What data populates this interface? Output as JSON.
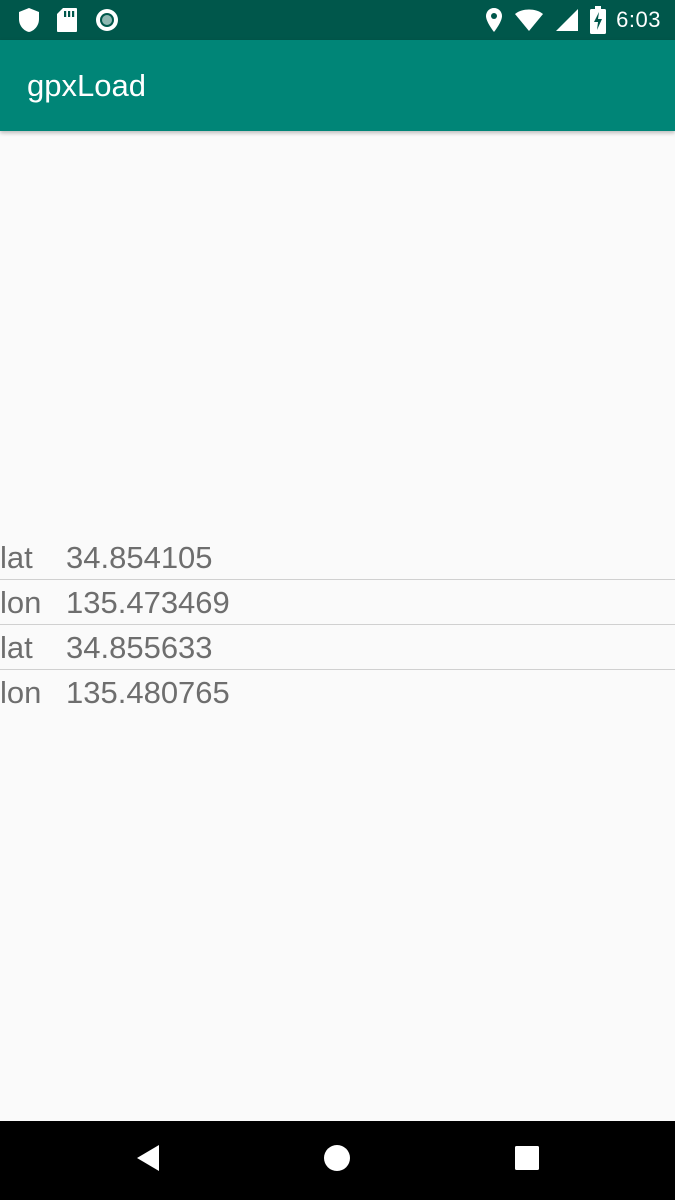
{
  "status_bar": {
    "time": "6:03",
    "left_icons": [
      "shield-icon",
      "sd-card-icon",
      "record-icon"
    ],
    "right_icons": [
      "location-pin-icon",
      "wifi-icon",
      "cell-signal-icon",
      "battery-charging-icon"
    ],
    "background_color": "#00574b"
  },
  "app_bar": {
    "title": "gpxLoad",
    "background_color": "#008577"
  },
  "coordinates": [
    {
      "key": "lat",
      "value": "34.854105"
    },
    {
      "key": "lon",
      "value": "135.473469"
    },
    {
      "key": "lat",
      "value": "34.855633"
    },
    {
      "key": "lon",
      "value": "135.480765"
    }
  ],
  "nav_bar": {
    "buttons": [
      "back-icon",
      "home-icon",
      "recents-icon"
    ]
  }
}
